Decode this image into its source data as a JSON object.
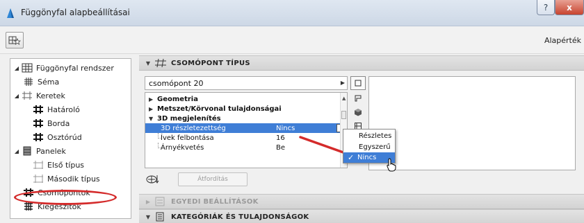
{
  "window": {
    "title": "Függönyfal alapbeállításai",
    "help_label": "?",
    "close_label": "x"
  },
  "toolbar": {
    "right_label": "Alapérték"
  },
  "tree": {
    "items": [
      {
        "label": "Függönyfal rendszer",
        "icon": "grid-icon"
      },
      {
        "label": "Séma",
        "icon": "pattern-icon"
      },
      {
        "label": "Keretek",
        "icon": "frame-icon"
      },
      {
        "label": "Határoló",
        "icon": "frame-member-icon"
      },
      {
        "label": "Borda",
        "icon": "frame-member-icon"
      },
      {
        "label": "Osztórúd",
        "icon": "frame-member-icon"
      },
      {
        "label": "Panelek",
        "icon": "panel-icon"
      },
      {
        "label": "Első típus",
        "icon": "panel-type-icon"
      },
      {
        "label": "Második típus",
        "icon": "panel-type-icon"
      },
      {
        "label": "Csomópontok",
        "icon": "junction-icon"
      },
      {
        "label": "Kiegészítők",
        "icon": "accessory-icon"
      }
    ]
  },
  "sections": {
    "junction_type": "CSOMÓPONT TÍPUS",
    "custom_settings": "EGYEDI BEÁLLÍTÁSOK",
    "categories": "KATEGÓRIÁK ÉS TULAJDONSÁGOK"
  },
  "junction": {
    "selected": "csomópont 20",
    "groups": [
      {
        "label": "Geometria"
      },
      {
        "label": "Metszet/Körvonal tulajdonságai"
      },
      {
        "label": "3D megjelenítés"
      }
    ],
    "params": [
      {
        "name": "3D részletezettség",
        "value": "Nincs"
      },
      {
        "name": "Ívek felbontása",
        "value": "16"
      },
      {
        "name": "Árnyékvetés",
        "value": "Be"
      }
    ]
  },
  "translate_button": "Átfordítás",
  "popup": {
    "options": [
      "Részletes",
      "Egyszerű",
      "Nincs"
    ],
    "selected_index": 2,
    "check": "✓"
  },
  "colors": {
    "highlight": "#3f7ed6",
    "annotation_red": "#d42b2b"
  }
}
